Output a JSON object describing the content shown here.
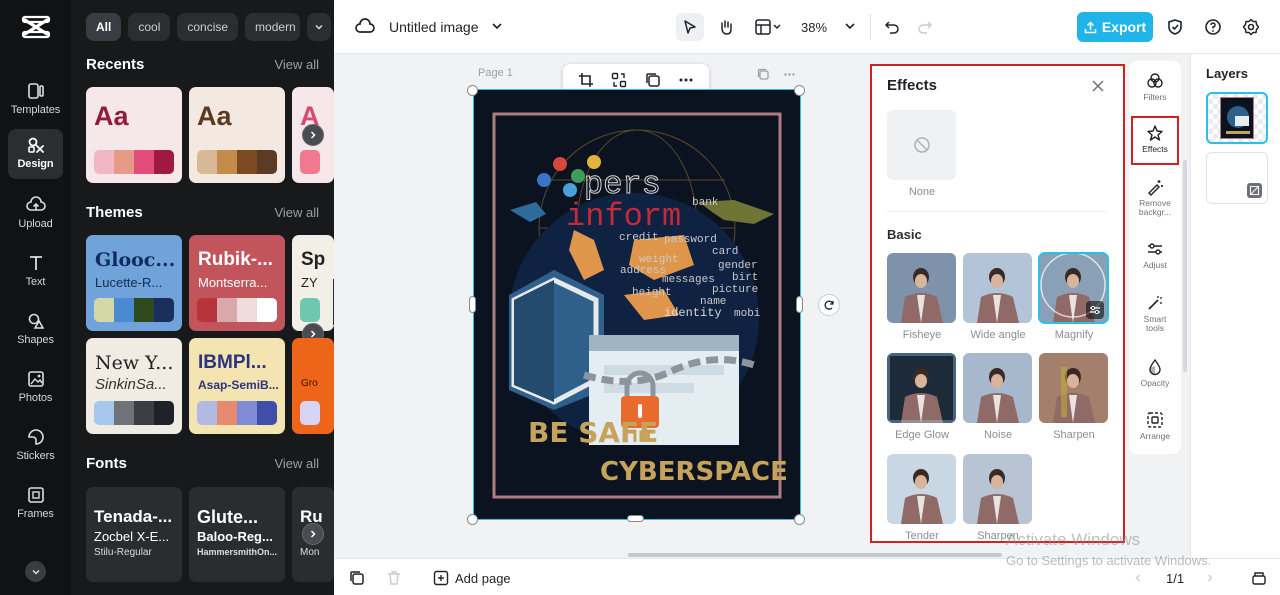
{
  "rail": {
    "items": [
      {
        "label": "Templates",
        "icon": "templates-icon"
      },
      {
        "label": "Design",
        "icon": "design-icon"
      },
      {
        "label": "Upload",
        "icon": "upload-icon"
      },
      {
        "label": "Text",
        "icon": "text-icon"
      },
      {
        "label": "Shapes",
        "icon": "shapes-icon"
      },
      {
        "label": "Photos",
        "icon": "photos-icon"
      },
      {
        "label": "Stickers",
        "icon": "stickers-icon"
      },
      {
        "label": "Frames",
        "icon": "frames-icon"
      }
    ]
  },
  "panel": {
    "chips": [
      "All",
      "cool",
      "concise",
      "modern"
    ],
    "recents": {
      "title": "Recents",
      "view_all": "View all",
      "cards": [
        "Aa",
        "Aa",
        "A"
      ]
    },
    "themes": {
      "title": "Themes",
      "view_all": "View all",
      "cards": [
        {
          "heading": "Glooc...",
          "sub": "Lucette-R..."
        },
        {
          "heading": "Rubik-...",
          "sub": "Montserra..."
        },
        {
          "heading": "Sp",
          "sub": "ZY"
        },
        {
          "heading": "New Y...",
          "sub": "SinkinSa..."
        },
        {
          "heading": "IBMPl...",
          "sub": "Asap-SemiB..."
        },
        {
          "heading": "",
          "sub": "Gro"
        }
      ]
    },
    "fonts": {
      "title": "Fonts",
      "view_all": "View all",
      "cards": [
        {
          "l1": "Tenada-...",
          "l2": "Zocbel X-E...",
          "l3": "Stilu-Regular"
        },
        {
          "l1": "Glute...",
          "l2": "Baloo-Reg...",
          "l3": "HammersmithOn..."
        },
        {
          "l1": "Ru",
          "l2": "",
          "l3": "Mon"
        }
      ]
    }
  },
  "topbar": {
    "title": "Untitled image",
    "zoom": "38%",
    "export_label": "Export"
  },
  "canvas": {
    "page_label": "Page 1"
  },
  "poster": {
    "words": [
      "pers",
      "inform",
      "bank",
      "credit",
      "password",
      "card",
      "weight",
      "gender",
      "address",
      "birt",
      "messages",
      "height",
      "picture",
      "name",
      "identity",
      "mobi"
    ],
    "line1": "BE SAFE",
    "line1b": "IN",
    "line2": "CYBERSPACE"
  },
  "effects": {
    "title": "Effects",
    "none_label": "None",
    "basic_label": "Basic",
    "items": [
      "Fisheye",
      "Wide angle",
      "Magnify",
      "Edge Glow",
      "Noise",
      "Sharpen",
      "Tender",
      "Sharpen"
    ]
  },
  "tools": [
    {
      "label": "Filters"
    },
    {
      "label": "Effects"
    },
    {
      "label": "Remove backgr..."
    },
    {
      "label": "Adjust"
    },
    {
      "label": "Smart tools"
    },
    {
      "label": "Opacity"
    },
    {
      "label": "Arrange"
    }
  ],
  "layers": {
    "title": "Layers"
  },
  "bottombar": {
    "add_page": "Add page",
    "page_count": "1/1"
  },
  "watermark": {
    "line1": "Activate Windows",
    "line2": "Go to Settings to activate Windows."
  },
  "colors": {
    "accent": "#1fb5e8",
    "highlight": "#d52020",
    "rail_bg": "#111214",
    "panel_bg": "#18191b"
  }
}
